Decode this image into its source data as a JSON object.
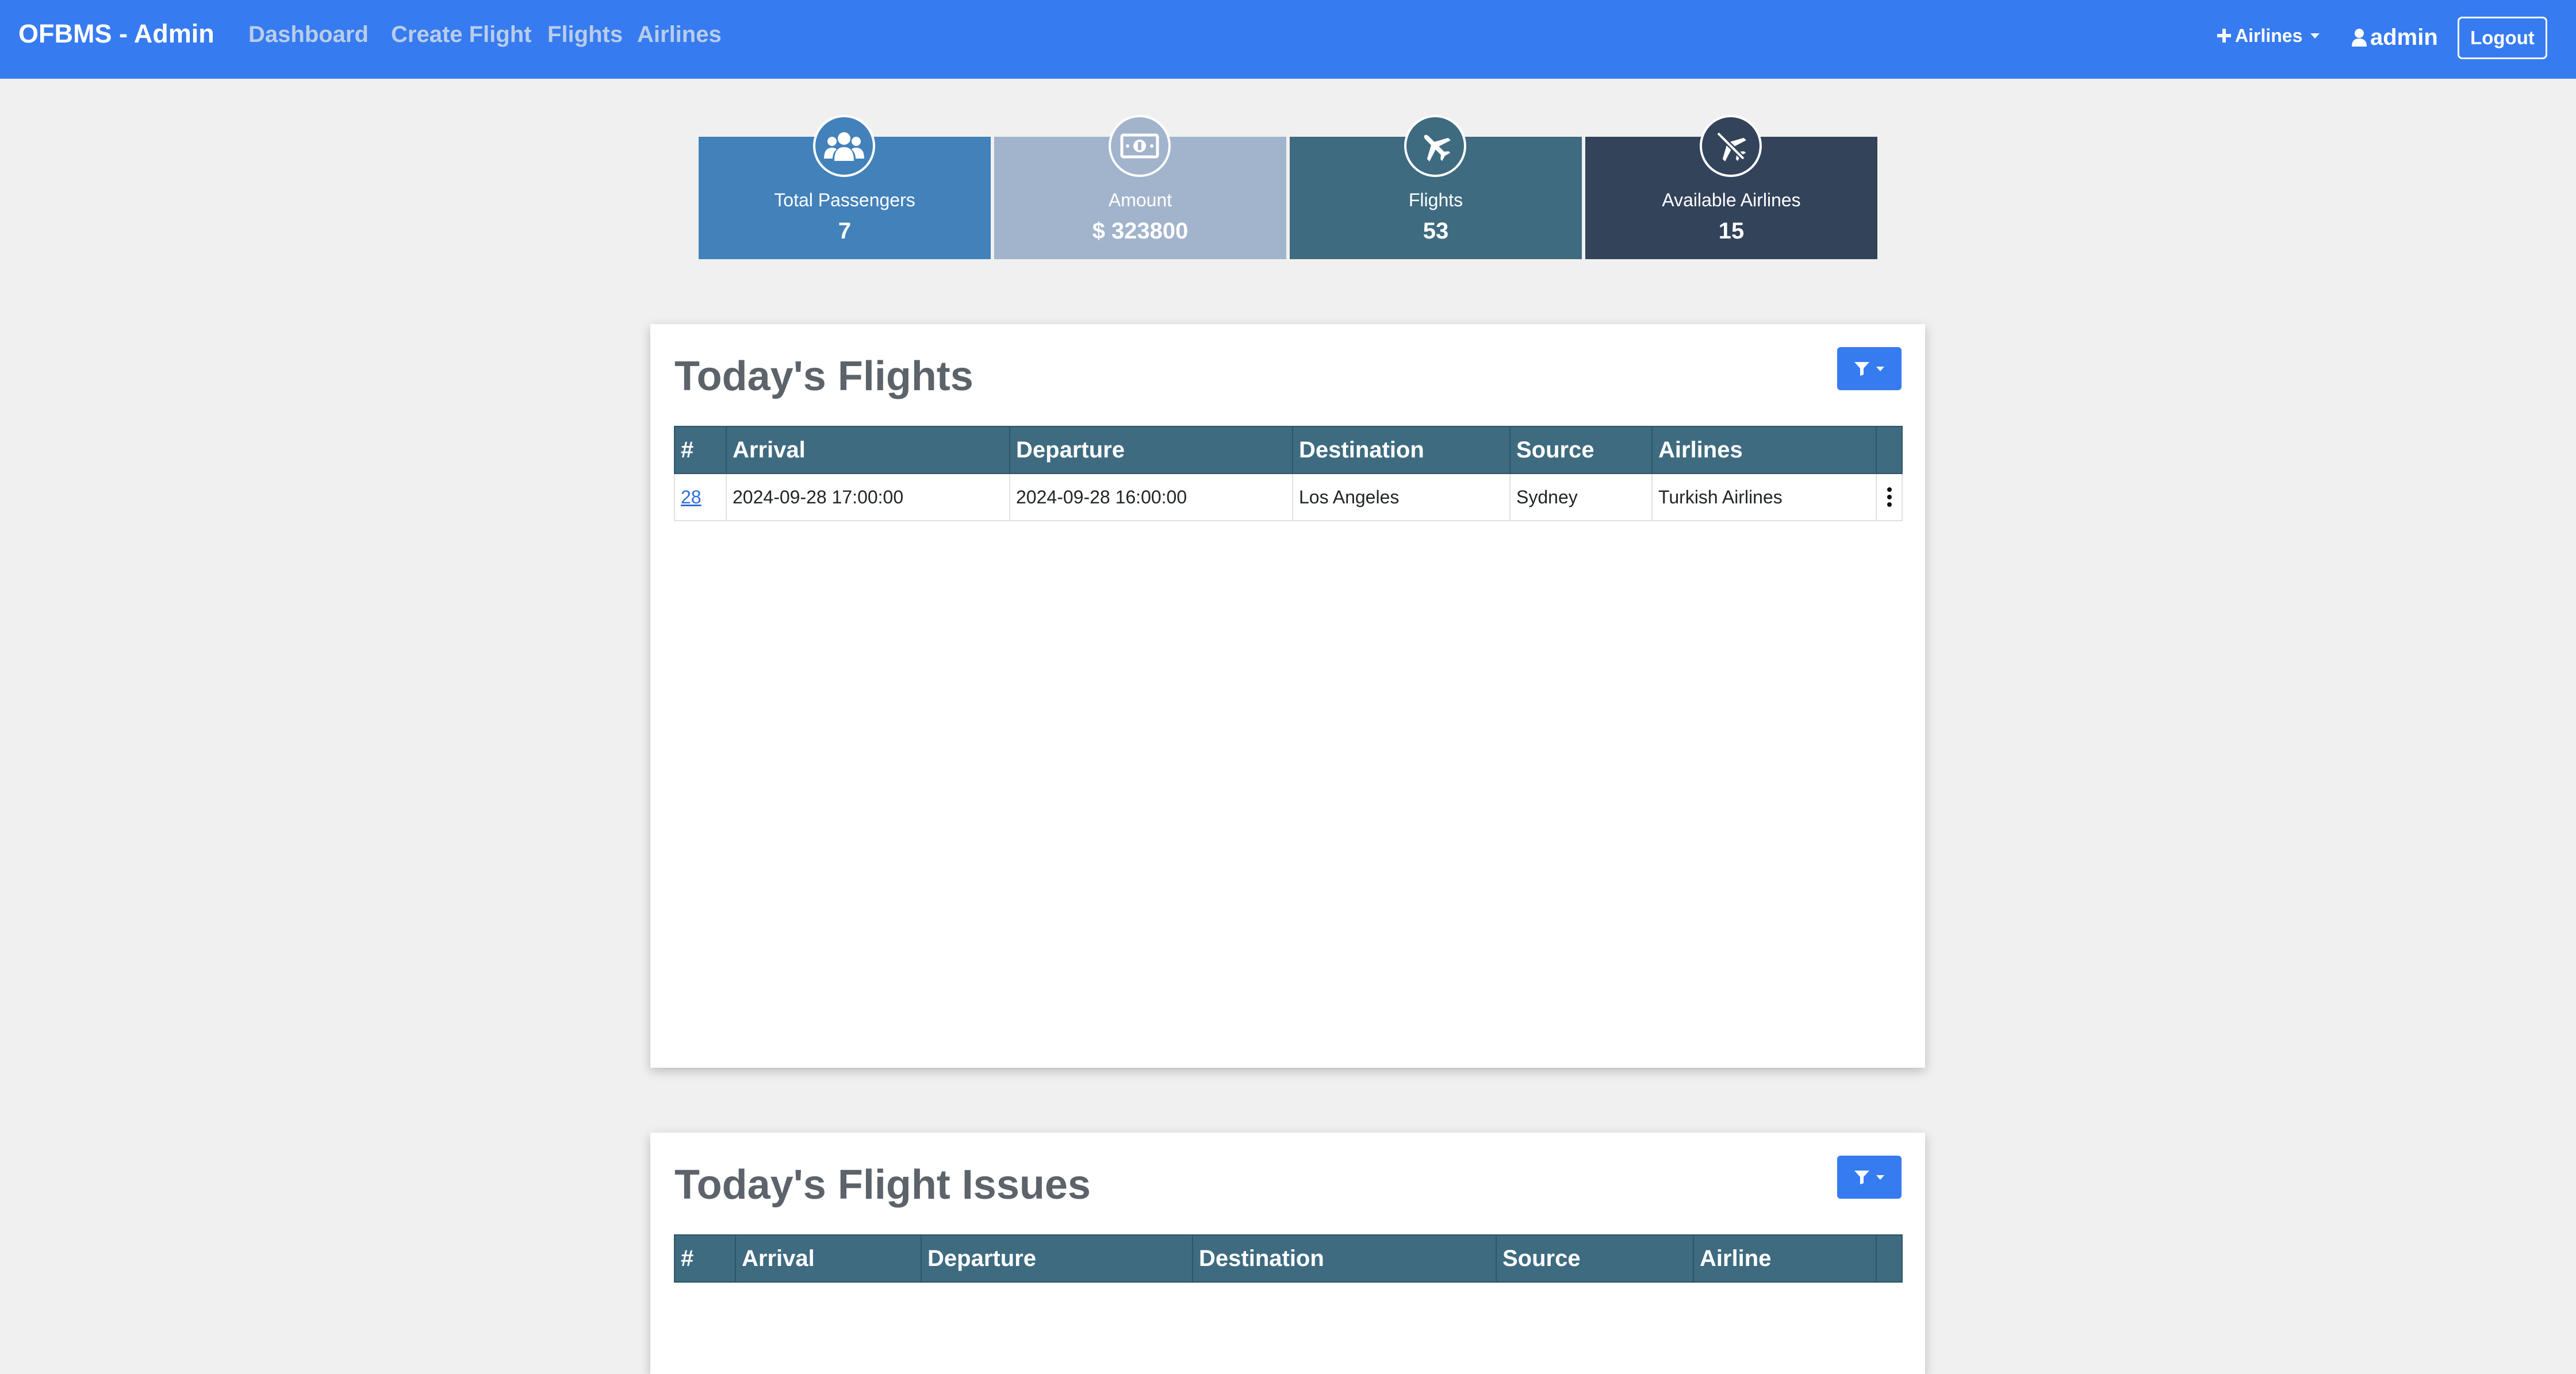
{
  "navbar": {
    "brand": "OFBMS - Admin",
    "links": [
      "Dashboard",
      "Create Flight",
      "Flights",
      "Airlines"
    ],
    "airlines_dropdown": "Airlines",
    "user": "admin",
    "logout": "Logout",
    "color": "#367bf0"
  },
  "stats": [
    {
      "label": "Total Passengers",
      "value": "7",
      "icon": "users-icon",
      "color": "#4281ba"
    },
    {
      "label": "Amount",
      "value": "$ 323800",
      "icon": "money-bill-icon",
      "color": "#a2b3cc"
    },
    {
      "label": "Flights",
      "value": "53",
      "icon": "plane-icon",
      "color": "#3e6b80"
    },
    {
      "label": "Available Airlines",
      "value": "15",
      "icon": "plane-slash-icon",
      "color": "#32435a"
    }
  ],
  "todays_flights": {
    "title": "Today's Flights",
    "columns": [
      "#",
      "Arrival",
      "Departure",
      "Destination",
      "Source",
      "Airlines"
    ],
    "rows": [
      {
        "id": "28",
        "arrival": "2024-09-28 17:00:00",
        "departure": "2024-09-28 16:00:00",
        "destination": "Los Angeles",
        "source": "Sydney",
        "airline": "Turkish Airlines"
      }
    ]
  },
  "todays_flight_issues": {
    "title": "Today's Flight Issues",
    "columns": [
      "#",
      "Arrival",
      "Departure",
      "Destination",
      "Source",
      "Airline"
    ],
    "rows": []
  },
  "colors": {
    "page_bg": "#f0f0f0",
    "table_header": "#3e6b80",
    "title_text": "#5c636a"
  }
}
